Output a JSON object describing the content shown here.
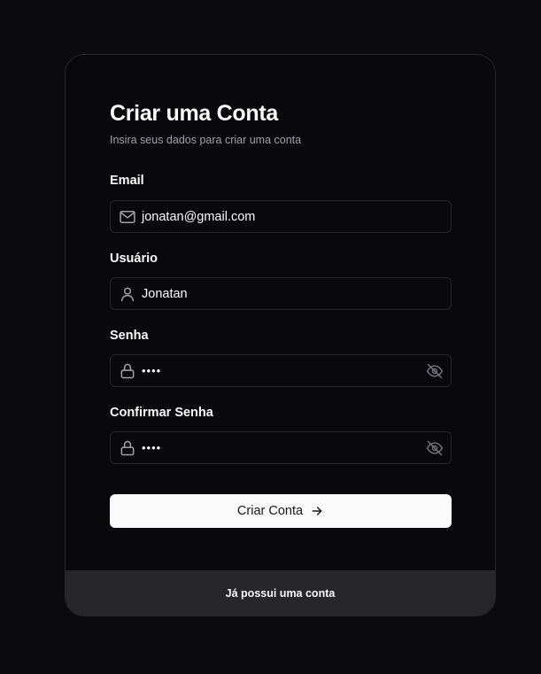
{
  "form": {
    "title": "Criar uma Conta",
    "subtitle": "Insira seus dados para criar uma conta",
    "fields": {
      "email": {
        "label": "Email",
        "value": "jonatan@gmail.com",
        "icon": "mail-icon"
      },
      "username": {
        "label": "Usuário",
        "value": "Jonatan",
        "icon": "user-icon"
      },
      "password": {
        "label": "Senha",
        "masked_value": "••••",
        "icon": "lock-icon",
        "toggle_icon": "eye-off-icon"
      },
      "confirm_password": {
        "label": "Confirmar Senha",
        "masked_value": "••••",
        "icon": "lock-icon",
        "toggle_icon": "eye-off-icon"
      }
    },
    "submit_label": "Criar Conta",
    "submit_icon": "arrow-right-icon"
  },
  "footer": {
    "login_link": "Já possui uma conta"
  },
  "colors": {
    "background": "#0b0b0d",
    "card": "#09090b",
    "border": "#27272a",
    "button": "#fafafa",
    "footer": "#27272a"
  }
}
